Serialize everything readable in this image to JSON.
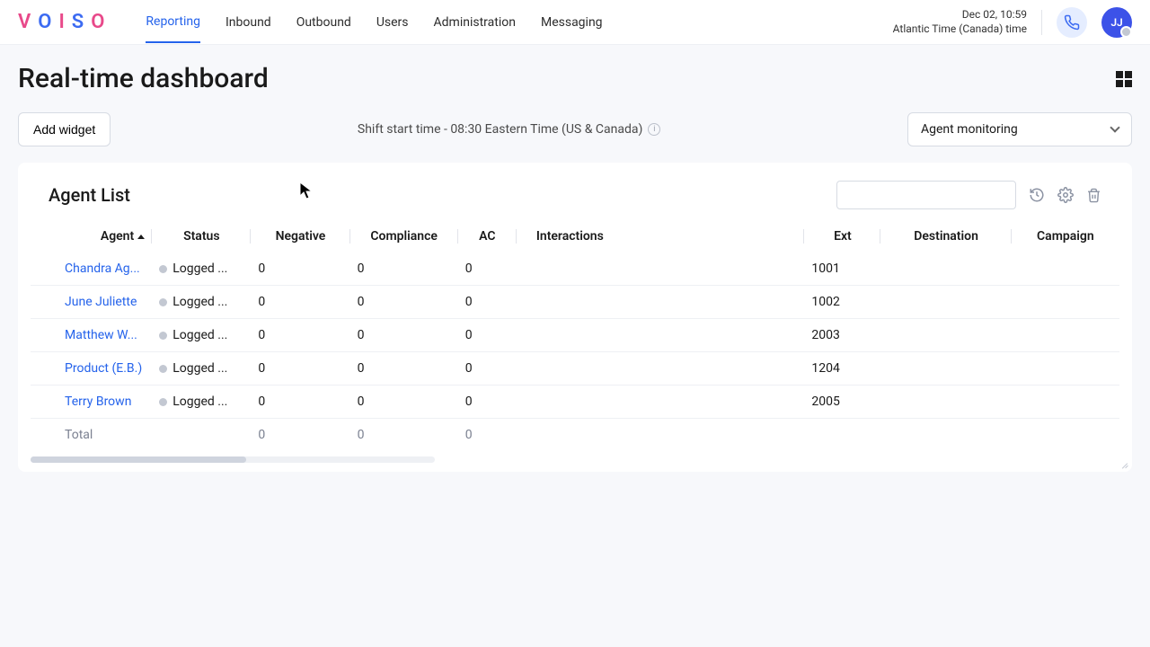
{
  "header": {
    "logo_letters": [
      "V",
      "O",
      "I",
      "S",
      "O"
    ],
    "nav": [
      "Reporting",
      "Inbound",
      "Outbound",
      "Users",
      "Administration",
      "Messaging"
    ],
    "active_nav_index": 0,
    "datetime": "Dec 02, 10:59",
    "timezone": "Atlantic Time (Canada) time",
    "avatar_initials": "JJ"
  },
  "page": {
    "title": "Real-time dashboard",
    "add_widget_label": "Add widget",
    "shift_info": "Shift start time - 08:30 Eastern Time (US & Canada)",
    "selector_value": "Agent monitoring"
  },
  "widget": {
    "title": "Agent List",
    "search_placeholder": "",
    "columns": [
      "Agent",
      "Status",
      "Negative",
      "Compliance",
      "AC",
      "Interactions",
      "Ext",
      "Destination",
      "Campaign"
    ],
    "rows": [
      {
        "agent": "Chandra Ag...",
        "status": "Logged ...",
        "negative": "0",
        "compliance": "0",
        "ac": "0",
        "interactions": "",
        "ext": "1001",
        "destination": "",
        "campaign": ""
      },
      {
        "agent": "June Juliette",
        "status": "Logged ...",
        "negative": "0",
        "compliance": "0",
        "ac": "0",
        "interactions": "",
        "ext": "1002",
        "destination": "",
        "campaign": ""
      },
      {
        "agent": "Matthew W...",
        "status": "Logged ...",
        "negative": "0",
        "compliance": "0",
        "ac": "0",
        "interactions": "",
        "ext": "2003",
        "destination": "",
        "campaign": ""
      },
      {
        "agent": "Product (E.B.)",
        "status": "Logged ...",
        "negative": "0",
        "compliance": "0",
        "ac": "0",
        "interactions": "",
        "ext": "1204",
        "destination": "",
        "campaign": ""
      },
      {
        "agent": "Terry Brown",
        "status": "Logged ...",
        "negative": "0",
        "compliance": "0",
        "ac": "0",
        "interactions": "",
        "ext": "2005",
        "destination": "",
        "campaign": ""
      }
    ],
    "total": {
      "label": "Total",
      "negative": "0",
      "compliance": "0",
      "ac": "0"
    }
  }
}
